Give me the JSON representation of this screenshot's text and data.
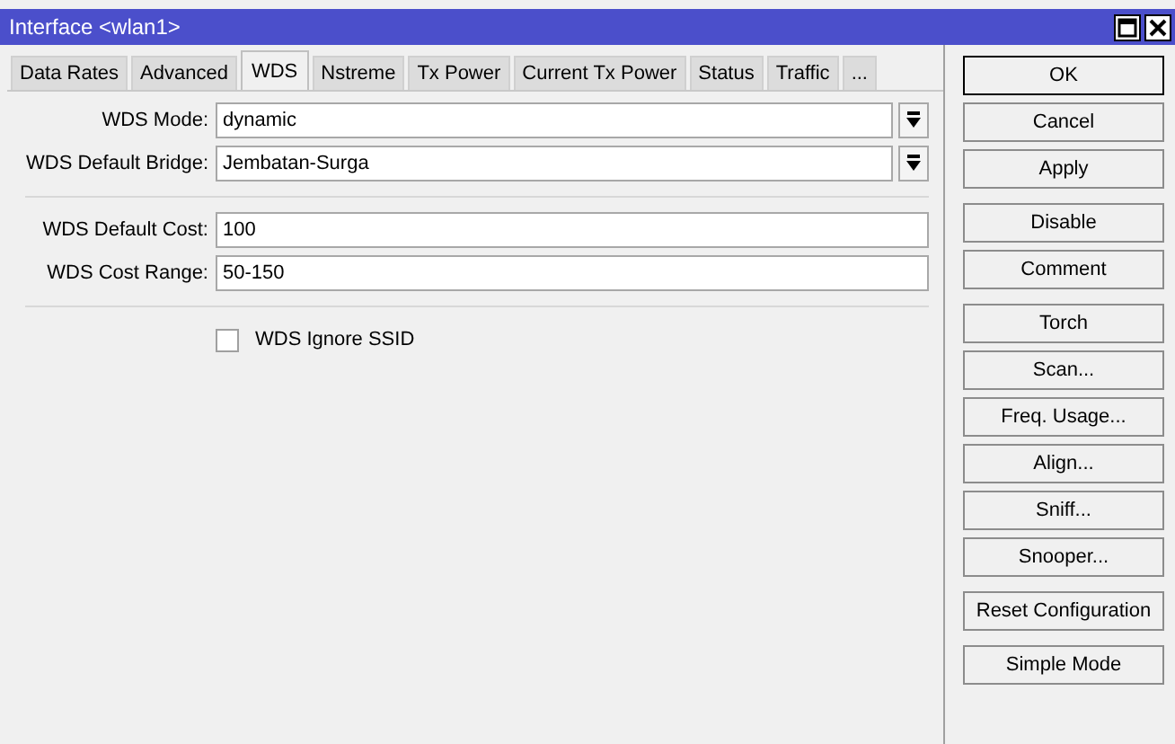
{
  "window": {
    "title": "Interface <wlan1>"
  },
  "tabs": [
    {
      "label": "Data Rates",
      "selected": false
    },
    {
      "label": "Advanced",
      "selected": false
    },
    {
      "label": "WDS",
      "selected": true
    },
    {
      "label": "Nstreme",
      "selected": false
    },
    {
      "label": "Tx Power",
      "selected": false
    },
    {
      "label": "Current Tx Power",
      "selected": false
    },
    {
      "label": "Status",
      "selected": false
    },
    {
      "label": "Traffic",
      "selected": false
    },
    {
      "label": "...",
      "selected": false
    }
  ],
  "sections": [
    [
      {
        "kind": "dropdown",
        "label": "WDS Mode:",
        "value": "dynamic"
      },
      {
        "kind": "dropdown",
        "label": "WDS Default Bridge:",
        "value": "Jembatan-Surga"
      }
    ],
    [
      {
        "kind": "text",
        "label": "WDS Default Cost:",
        "value": "100"
      },
      {
        "kind": "text",
        "label": "WDS Cost Range:",
        "value": "50-150"
      }
    ],
    [
      {
        "kind": "checkbox",
        "label": "WDS Ignore SSID",
        "checked": false
      }
    ]
  ],
  "button_groups": [
    [
      {
        "label": "OK",
        "default": true
      },
      {
        "label": "Cancel",
        "default": false
      },
      {
        "label": "Apply",
        "default": false
      }
    ],
    [
      {
        "label": "Disable",
        "default": false
      },
      {
        "label": "Comment",
        "default": false
      }
    ],
    [
      {
        "label": "Torch",
        "default": false
      },
      {
        "label": "Scan...",
        "default": false
      },
      {
        "label": "Freq. Usage...",
        "default": false
      },
      {
        "label": "Align...",
        "default": false
      },
      {
        "label": "Sniff...",
        "default": false
      },
      {
        "label": "Snooper...",
        "default": false
      }
    ],
    [
      {
        "label": "Reset Configuration",
        "default": false
      }
    ],
    [
      {
        "label": "Simple Mode",
        "default": false
      }
    ]
  ]
}
